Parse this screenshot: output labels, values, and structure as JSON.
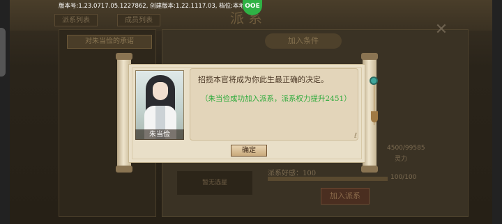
{
  "hud": {
    "version": "版本号:1.23.0717.05.1227862, 创建版本:1.22.1117.03, 档位:本地档1",
    "badge": "OOE"
  },
  "background": {
    "title": "派系",
    "tabs": [
      "派系列表",
      "成员列表"
    ],
    "left_label": "对朱当俭的承诺",
    "panel_header": "加入条件",
    "stat_value": "4500/99585",
    "stat_label": "灵力",
    "favor_label": "派系好感：100",
    "favor_value": "100/100",
    "favor_fraction": 1.0,
    "empty_box": "暂无选星",
    "join_button": "加入派系"
  },
  "dialog": {
    "character_name": "朱当俭",
    "message": "招揽本官将成为你此生最正确的决定。",
    "result": "（朱当俭成功加入派系，派系权力提升2451）",
    "confirm_label": "确定"
  },
  "colors": {
    "result_text": "#2eab3c",
    "dialog_bg": "#e9dfc8",
    "badge": "#2fb245"
  }
}
